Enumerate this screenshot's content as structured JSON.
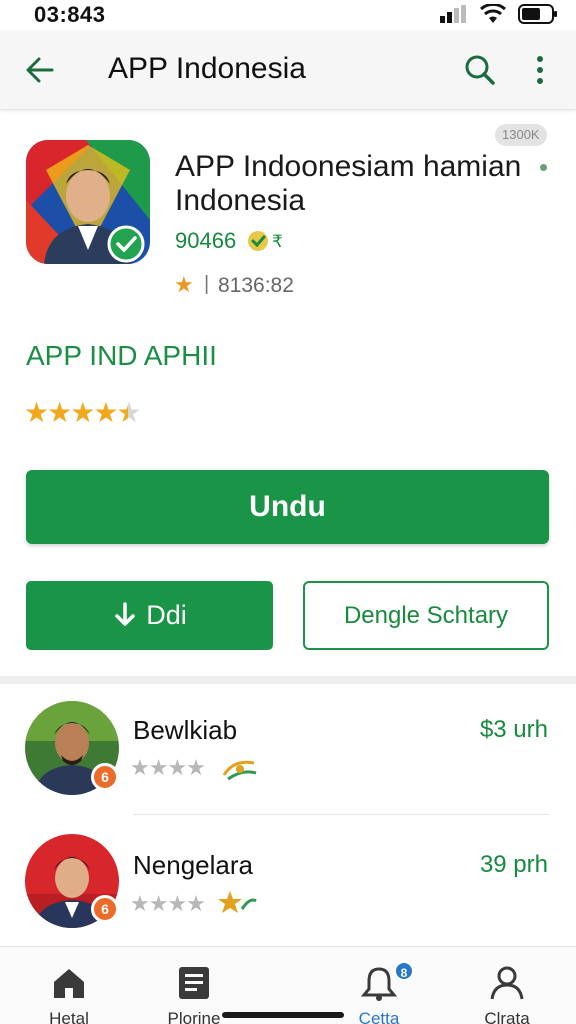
{
  "status_bar": {
    "time": "03:843"
  },
  "app_bar": {
    "title": "APP Indonesia"
  },
  "app": {
    "size_pill": "1300K",
    "name": "APP Indoonesiam hamian Indonesia",
    "developer": "90466",
    "developer_tail": "₹",
    "meta_value": "8136:82"
  },
  "section": {
    "title": "APP IND   APHII"
  },
  "rating": {
    "stars": 4.5,
    "max": 5
  },
  "buttons": {
    "install": "Undu",
    "download": "Ddi",
    "secondary": "Dengle Schtary"
  },
  "reviewers": [
    {
      "name": "Bewlkiab",
      "price": "$3 urh",
      "badge": "6",
      "stars": 4
    },
    {
      "name": "Nengelara",
      "price": "39 prh",
      "badge": "6",
      "stars": 4
    }
  ],
  "bottom_nav": [
    {
      "label": "Hetal",
      "icon": "home-icon"
    },
    {
      "label": "Plorine",
      "icon": "document-icon"
    },
    {
      "label": "Cetta",
      "icon": "notification-icon",
      "badge": "8"
    },
    {
      "label": "Clrata",
      "icon": "profile-icon"
    }
  ],
  "colors": {
    "accent": "#1a9447",
    "accent_text": "#178a3e",
    "star": "#f0a81d",
    "badge": "#ea6b2a"
  }
}
